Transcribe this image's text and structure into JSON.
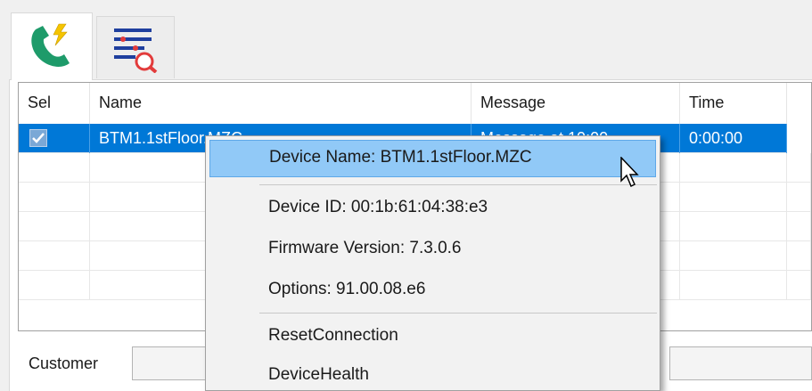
{
  "tabs": [
    {
      "icon": "phone-icon",
      "active": true
    },
    {
      "icon": "filter-search-icon",
      "active": false
    }
  ],
  "grid": {
    "columns": [
      "Sel",
      "Name",
      "Message",
      "Time"
    ],
    "rows": [
      {
        "selected": true,
        "checked": true,
        "name": "BTM1.1stFloor.MZC",
        "message": "Message at 10:00",
        "time": "0:00:00"
      }
    ],
    "empty_rows": 5
  },
  "customer": {
    "label": "Customer",
    "value": ""
  },
  "context_menu": {
    "items": [
      {
        "label": "Device Name: BTM1.1stFloor.MZC",
        "hover": true
      },
      {
        "label": "Device ID: 00:1b:61:04:38:e3"
      },
      {
        "label": "Firmware Version: 7.3.0.6"
      },
      {
        "label": "Options: 91.00.08.e6"
      },
      {
        "label": "ResetConnection"
      },
      {
        "label": "DeviceHealth"
      }
    ]
  },
  "colors": {
    "selection": "#0078d7",
    "menu_hover": "#91c9f7",
    "phone_icon": "#1e9b6a",
    "bolt": "#f5c400",
    "filter_line": "#1f3f9e",
    "filter_accent": "#e23b3b"
  }
}
